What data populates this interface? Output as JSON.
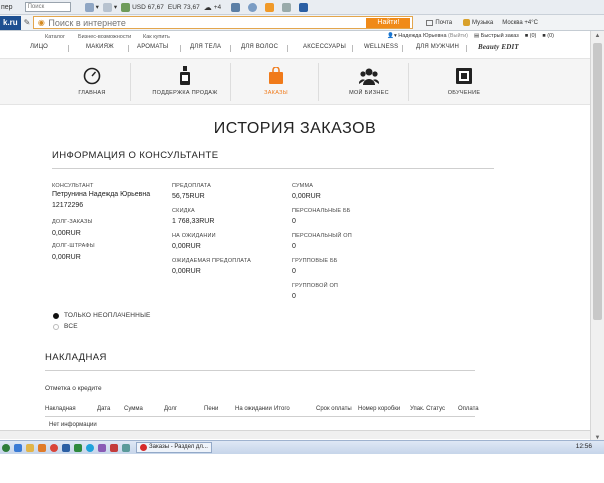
{
  "chrome": {
    "tab_fragment": "пер",
    "mini_search_placeholder": "Поиск",
    "usd": "USD 67,67",
    "eur": "EUR 73,67",
    "weather_small": "+4",
    "site_tag": "k.ru",
    "search_placeholder": "Поиск в интернете",
    "find_button": "Найти!",
    "mail": "Почта",
    "music": "Музыка",
    "weather": "Москва +4°C"
  },
  "header": {
    "util_links": [
      "Каталог",
      "Бизнес-возможности",
      "Как купить"
    ],
    "user_name": "Надежда Юрьевна",
    "logout": "(Выйти)",
    "quick_order": "Быстрый заказ",
    "cart_count": "(0)",
    "fav_count": "(0)",
    "categories": [
      "ЛИЦО",
      "МАКИЯЖ",
      "АРОМАТЫ",
      "ДЛЯ ТЕЛА",
      "ДЛЯ ВОЛОС",
      "АКСЕССУАРЫ",
      "WELLNESS",
      "ДЛЯ МУЖЧИН"
    ],
    "brand": "Beauty EDIT"
  },
  "nav": [
    {
      "label": "ГЛАВНАЯ",
      "icon": "gauge-icon"
    },
    {
      "label": "ПОДДЕРЖКА ПРОДАЖ",
      "icon": "perfume-icon"
    },
    {
      "label": "ЗАКАЗЫ",
      "icon": "shopping-bag-icon"
    },
    {
      "label": "МОЙ БИЗНЕС",
      "icon": "people-icon"
    },
    {
      "label": "ОБУЧЕНИЕ",
      "icon": "book-icon"
    }
  ],
  "page": {
    "title": "ИСТОРИЯ ЗАКАЗОВ",
    "consultant_section": "ИНФОРМАЦИЯ О КОНСУЛЬТАНТЕ",
    "invoice_section": "НАКЛАДНАЯ",
    "credit_note": "Отметка о кредите",
    "no_info": "Нет информации"
  },
  "consultant": {
    "label": "КОНСУЛЬТАНТ",
    "name": "Петрунина Надежда Юрьевна",
    "id": "12172296",
    "debt_orders_label": "ДОЛГ-ЗАКАЗЫ",
    "debt_orders": "0,00RUR",
    "debt_fines_label": "ДОЛГ-ШТРАФЫ",
    "debt_fines": "0,00RUR"
  },
  "prepay": {
    "prepay_label": "ПРЕДОПЛАТА",
    "prepay": "56,75RUR",
    "discount_label": "СКИДКА",
    "discount": "1 768,33RUR",
    "pending_label": "НА ОЖИДАНИИ",
    "pending": "0,00RUR",
    "expected_prepay_label": "ОЖИДАЕМАЯ ПРЕДОПЛАТА",
    "expected_prepay": "0,00RUR"
  },
  "totals": {
    "sum_label": "СУММА",
    "sum": "0,00RUR",
    "personal_bb_label": "ПЕРСОНАЛЬНЫЕ ББ",
    "personal_bb": "0",
    "personal_op_label": "ПЕРСОНАЛЬНЫЙ ОП",
    "personal_op": "0",
    "group_bb_label": "ГРУППОВЫЕ ББ",
    "group_bb": "0",
    "group_op_label": "ГРУППОВОЙ ОП",
    "group_op": "0"
  },
  "filter": {
    "unpaid_only": "ТОЛЬКО НЕОПЛАЧЕННЫЕ",
    "all": "ВСЕ"
  },
  "table": {
    "columns": [
      "Накладная",
      "Дата",
      "Сумма",
      "Долг",
      "Пени",
      "На ожидании",
      "Итого",
      "Срок оплаты",
      "Номер коробки",
      "Упак. Статус",
      "Оплата"
    ]
  },
  "taskbar": {
    "task_title": "Заказы - Раздел дл...",
    "clock": "12:56"
  },
  "colors": {
    "accent": "#f07a1a",
    "find_button": "#f08a18",
    "site_tag": "#1d4f91"
  }
}
